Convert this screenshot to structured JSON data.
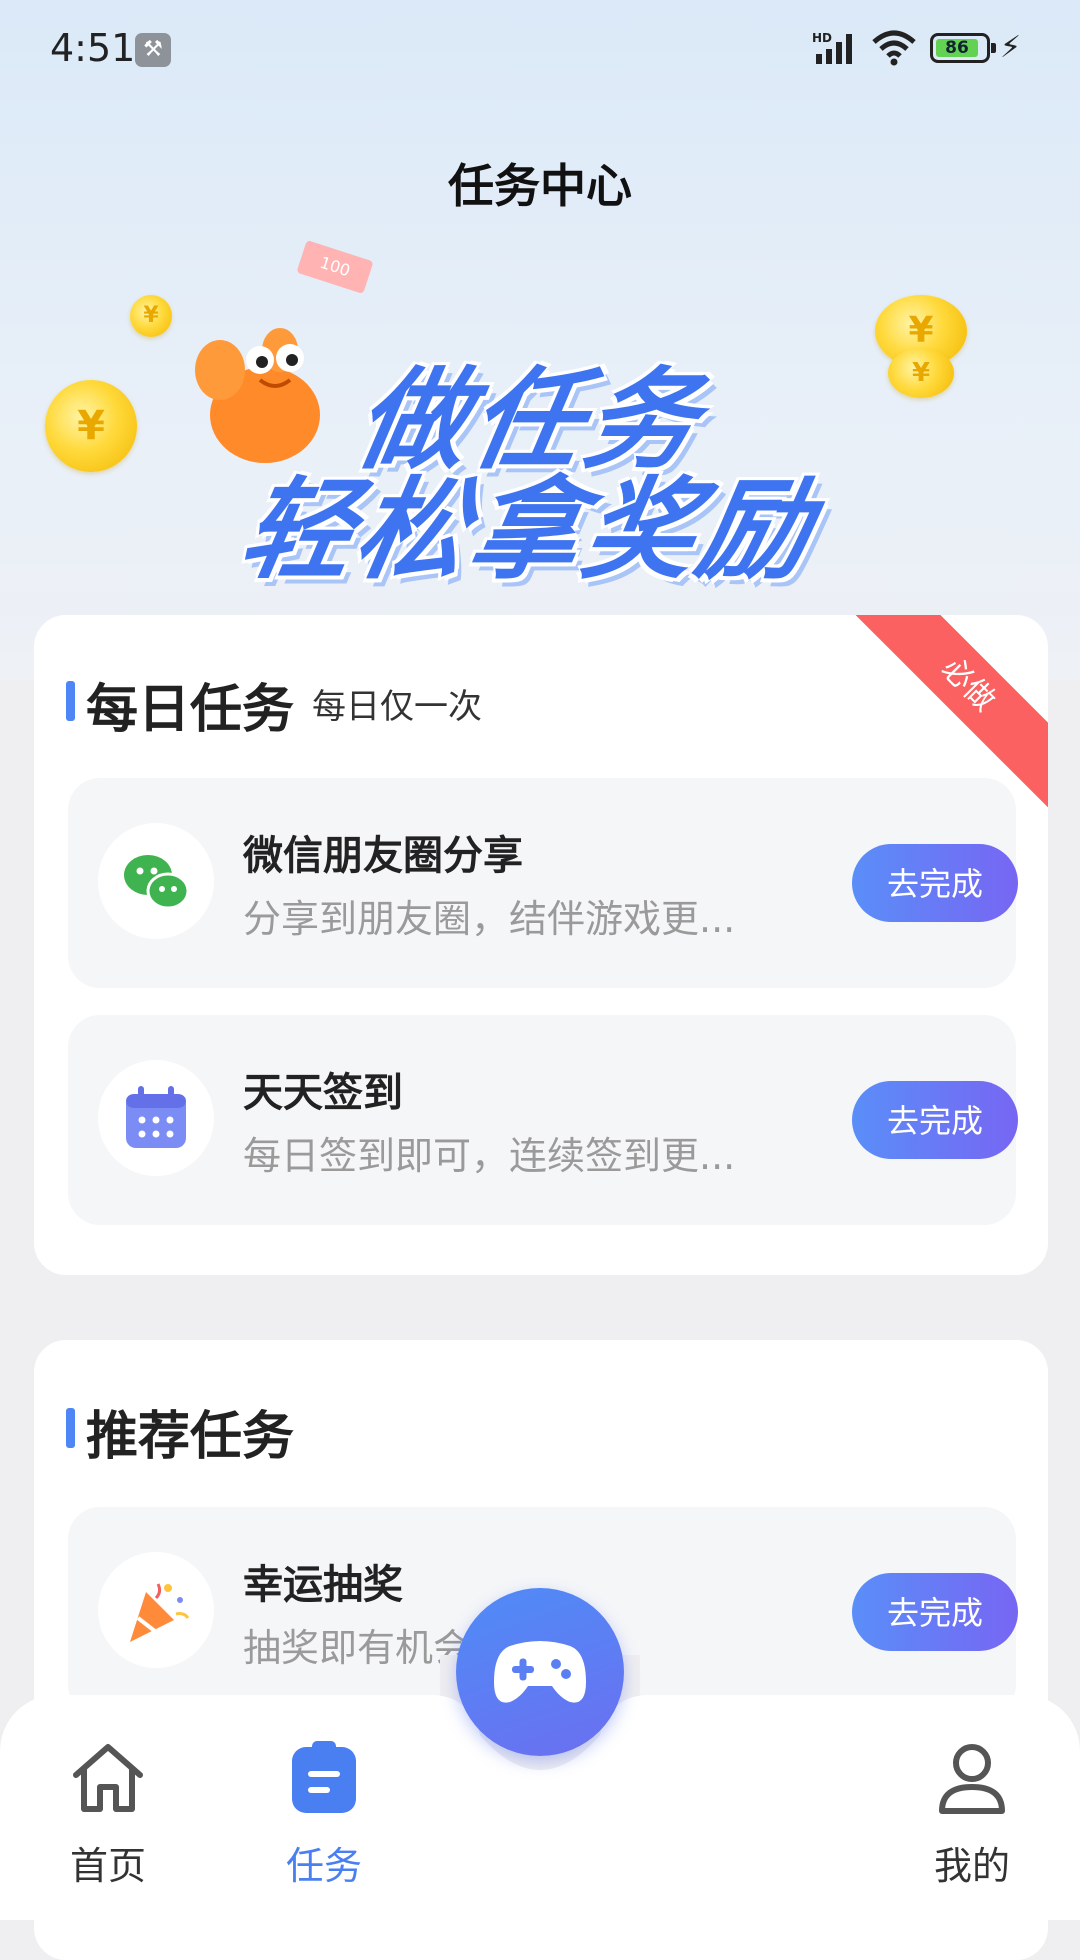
{
  "status_bar": {
    "time": "4:51",
    "battery": "86",
    "network": "HD"
  },
  "header": {
    "title": "任务中心"
  },
  "banner": {
    "line1": "做任务",
    "line2": "轻松拿奖励",
    "bill_text": "100",
    "coin_symbol": "¥"
  },
  "daily": {
    "title": "每日任务",
    "subtitle": "每日仅一次",
    "ribbon": "必做",
    "tasks": [
      {
        "title": "微信朋友圈分享",
        "desc": "分享到朋友圈，结伴游戏更...",
        "button": "去完成",
        "icon": "wechat-icon"
      },
      {
        "title": "天天签到",
        "desc": "每日签到即可，连续签到更...",
        "button": "去完成",
        "icon": "calendar-icon"
      }
    ]
  },
  "recommended": {
    "title": "推荐任务",
    "tasks": [
      {
        "title": "幸运抽奖",
        "desc": "抽奖即有机会获得奖",
        "button": "去完成",
        "icon": "party-popper-icon"
      }
    ]
  },
  "nav": {
    "items": [
      {
        "label": "首页",
        "icon": "home-icon",
        "active": false
      },
      {
        "label": "任务",
        "icon": "task-clipboard-icon",
        "active": true
      },
      {
        "label": "我的",
        "icon": "user-icon",
        "active": false
      }
    ],
    "center_icon": "gamepad-icon"
  },
  "colors": {
    "accent": "#4a7ff2",
    "ribbon": "#fa6160",
    "button_start": "#5a8ef8",
    "button_end": "#7766f3"
  }
}
